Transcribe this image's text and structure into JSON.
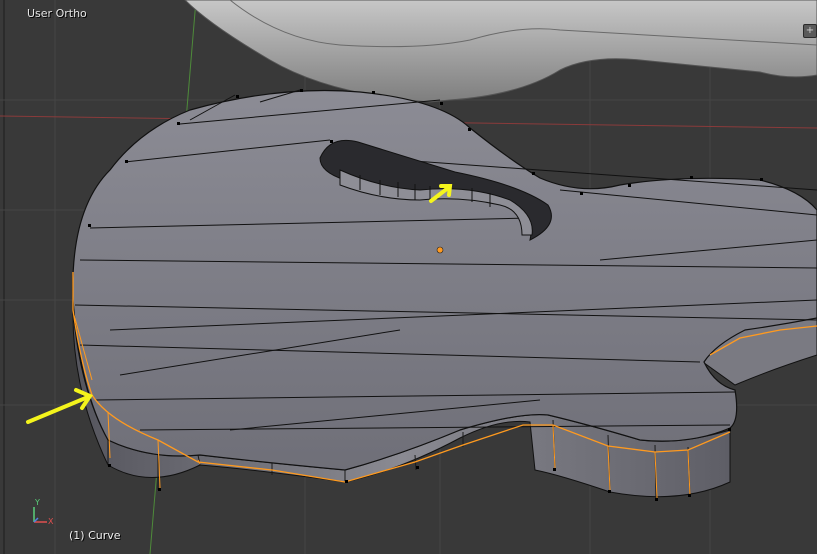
{
  "viewport": {
    "view_name": "User Ortho",
    "object_name": "(1) Curve",
    "toggle_glyph": "+"
  },
  "axes_gizmo": {
    "x_label": "X",
    "y_label": "Y"
  },
  "colors": {
    "background": "#393939",
    "grid": "#454545",
    "axis_x": "#8a3b3b",
    "axis_y": "#4e8b3a",
    "mesh_top": "#7d7d86",
    "mesh_side": "#6a6a72",
    "wire": "#111111",
    "selected_edge": "#ff9a1f",
    "annotation": "#f4f41c"
  },
  "icons": [
    "view-toggle-icon",
    "axes-gizmo-icon",
    "annotation-arrow-icon",
    "object-origin-icon"
  ]
}
